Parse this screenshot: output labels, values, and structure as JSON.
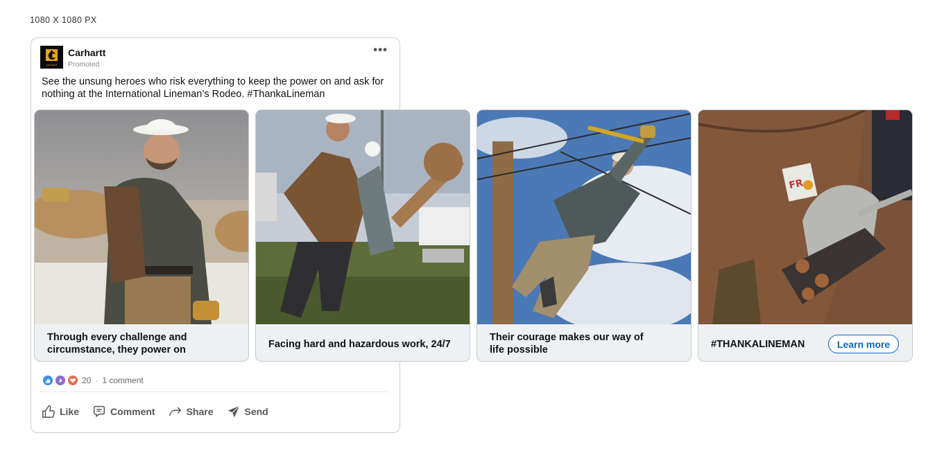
{
  "canvas_label": "1080 X 1080 PX",
  "post": {
    "brand_name": "Carhartt",
    "logo_text": "carhartt",
    "sponsored_label": "Promoted",
    "text": "See the unsung heroes who risk everything to keep the power on and ask for nothing at the International Lineman’s Rodeo. #ThankaLineman",
    "more_icon": "ellipsis-icon"
  },
  "carousel": [
    {
      "caption": "Through every challenge and circumstance, they power on",
      "image": "lineman-portrait-photo"
    },
    {
      "caption": "Facing hard and hazardous work, 24/7",
      "image": "lineman-hauling-pole-photo"
    },
    {
      "caption": "Their courage makes our way of life possible",
      "image": "lineman-climbing-pole-photo"
    },
    {
      "caption": "#THANKALINEMAN",
      "image": "gloved-hand-pliers-photo",
      "cta": "Learn more"
    }
  ],
  "social": {
    "reaction_count": "20",
    "separator": "·",
    "comments": "1 comment",
    "reaction_icons": [
      "like-icon",
      "celebrate-icon",
      "love-icon"
    ]
  },
  "actions": {
    "like": "Like",
    "comment": "Comment",
    "share": "Share",
    "send": "Send"
  },
  "colors": {
    "accent": "#0a66c2",
    "card_bg": "#eef1f4",
    "logo_orange": "#e9a21b"
  }
}
